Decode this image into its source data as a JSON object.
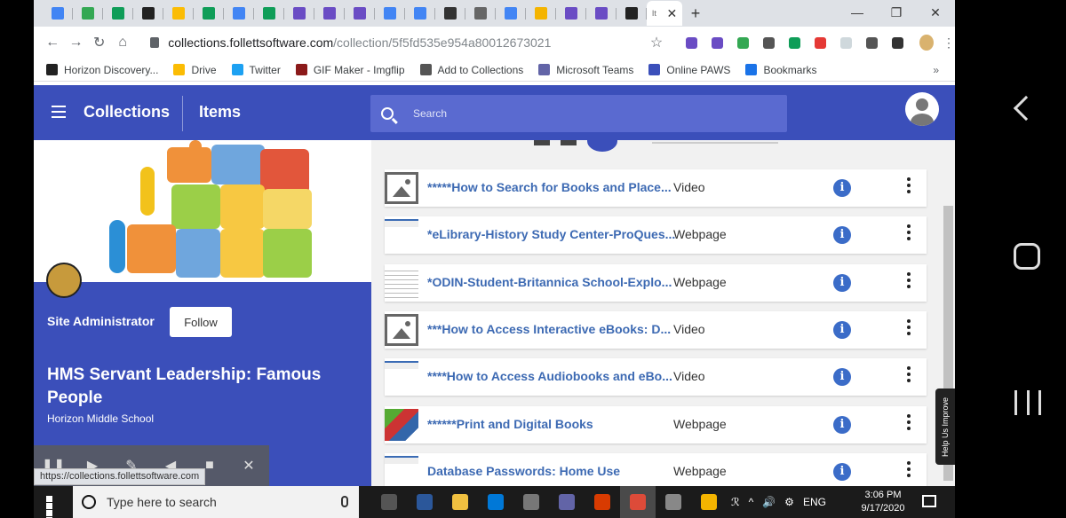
{
  "browser": {
    "tabs": [
      {
        "color": "#4285f4"
      },
      {
        "color": "#34a853"
      },
      {
        "color": "#0f9d58"
      },
      {
        "color": "#222222"
      },
      {
        "color": "#fbbc04"
      },
      {
        "color": "#0f9d58"
      },
      {
        "color": "#4285f4"
      },
      {
        "color": "#0f9d58"
      },
      {
        "color": "#6a4cc4"
      },
      {
        "color": "#6a4cc4"
      },
      {
        "color": "#6a4cc4"
      },
      {
        "color": "#4285f4"
      },
      {
        "color": "#4285f4"
      },
      {
        "color": "#333333"
      },
      {
        "color": "#666666"
      },
      {
        "color": "#4285f4"
      },
      {
        "color": "#f4b400"
      },
      {
        "color": "#6a4cc4"
      },
      {
        "color": "#6a4cc4"
      },
      {
        "color": "#222222"
      }
    ],
    "active_tab_label": "It",
    "active_tab_close": "✕",
    "new_tab": "+",
    "window_controls": {
      "minimize": "—",
      "maximize": "❐",
      "close": "✕"
    },
    "nav": {
      "back": "←",
      "forward": "→",
      "reload": "↻",
      "home": "⌂"
    },
    "url_host": "collections.follettsoftware.com",
    "url_path": "/collection/5f5fd535e954a80012673021",
    "star": "☆",
    "extension_colors": [
      "#6a4cc4",
      "#6a4cc4",
      "#34a853",
      "#555555",
      "#0f9d58",
      "#e53935",
      "#cfd8dc",
      "#555555",
      "#333333"
    ],
    "menu": "⋮",
    "bookmarks": [
      {
        "label": "Horizon Discovery...",
        "icon": "horizon-icon",
        "color": "#222222"
      },
      {
        "label": "Drive",
        "icon": "drive-icon",
        "color": "#fbbc04"
      },
      {
        "label": "Twitter",
        "icon": "twitter-icon",
        "color": "#1da1f2"
      },
      {
        "label": "GIF Maker - Imgflip",
        "icon": "imgflip-icon",
        "color": "#8b1a1a"
      },
      {
        "label": "Add to Collections",
        "icon": "globe-icon",
        "color": "#555555"
      },
      {
        "label": "Microsoft Teams",
        "icon": "teams-icon",
        "color": "#6264a7"
      },
      {
        "label": "Online PAWS",
        "icon": "calendar-icon",
        "color": "#3b4fba"
      },
      {
        "label": "Bookmarks",
        "icon": "star-icon",
        "color": "#1a73e8"
      }
    ],
    "bookmarks_more": "»",
    "status_url": "https://collections.follettsoftware.com"
  },
  "app": {
    "nav_collections": "Collections",
    "nav_items": "Items",
    "search_placeholder": "Search",
    "accent": "#3b4fba"
  },
  "collection": {
    "owner": "Site Administrator",
    "follow_label": "Follow",
    "title": "HMS Servant Leadership: Famous People",
    "school": "Horizon Middle School",
    "media_controls": [
      "❚❚",
      "▶",
      "✎",
      "◀",
      "■",
      "✕"
    ]
  },
  "items": [
    {
      "title": "*****How to Search for Books and Place...",
      "type": "Video",
      "thumb": "video"
    },
    {
      "title": "*eLibrary-History Study Center-ProQues...",
      "type": "Webpage",
      "thumb": "web"
    },
    {
      "title": "*ODIN-Student-Britannica School-Explo...",
      "type": "Webpage",
      "thumb": "doc"
    },
    {
      "title": "***How to Access Interactive eBooks: D...",
      "type": "Video",
      "thumb": "video"
    },
    {
      "title": "****How to Access Audiobooks and eBo...",
      "type": "Video",
      "thumb": "web"
    },
    {
      "title": "******Print and Digital Books",
      "type": "Webpage",
      "thumb": "books"
    },
    {
      "title": "Database Passwords: Home Use",
      "type": "Webpage",
      "thumb": "web"
    }
  ],
  "info_glyph": "i",
  "feedback_label": "Help Us Improve",
  "taskbar": {
    "search_placeholder": "Type here to search",
    "apps": [
      "#555555",
      "#2b579a",
      "#f0c040",
      "#0078d7",
      "#777777",
      "#6264a7",
      "#d83b01",
      "#dd4b39",
      "#888888",
      "#f4b400"
    ],
    "tray": [
      "ℛ",
      "^",
      "🔊",
      "⚙",
      "ENG"
    ],
    "time": "3:06 PM",
    "date": "9/17/2020"
  }
}
